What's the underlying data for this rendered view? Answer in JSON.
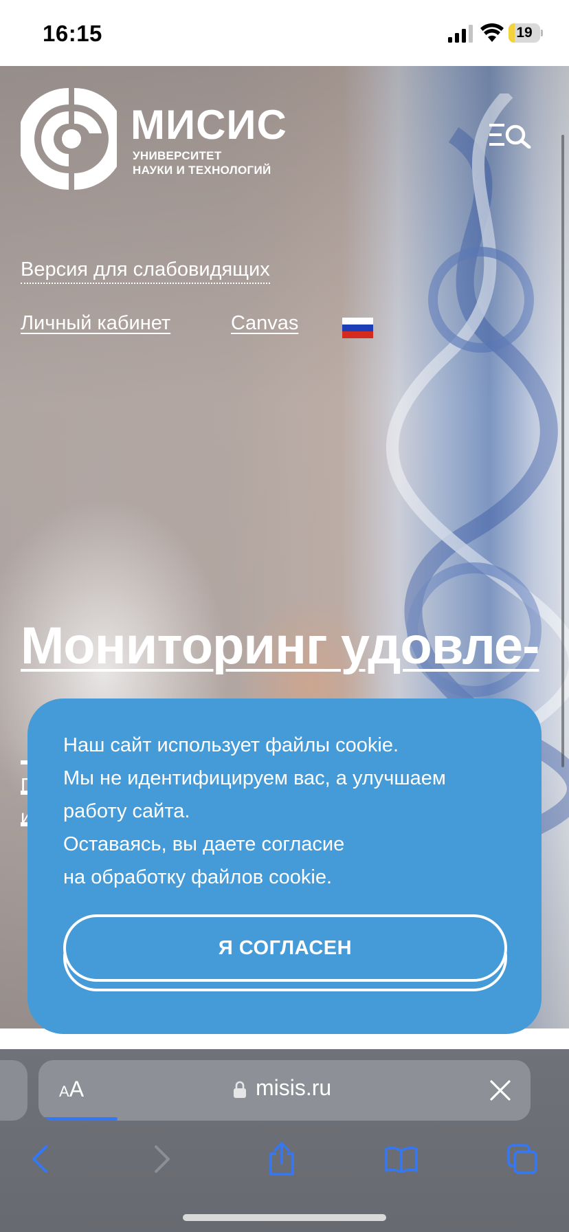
{
  "status_bar": {
    "time": "16:15",
    "battery_level": "19",
    "battery_fraction": 0.19,
    "icons": [
      "signal-icon",
      "wifi-icon",
      "battery-icon"
    ]
  },
  "site": {
    "brand_name": "МИСИС",
    "brand_sub_line1": "УНИВЕРСИТЕТ",
    "brand_sub_line2": "НАУКИ И ТЕХНОЛОГИЙ",
    "menu_icon": "menu-search-icon",
    "low_vision_link": "Версия для слабовидящих",
    "cabinet_link": "Личный кабинет",
    "canvas_link": "Canvas",
    "language_flag": "ru-flag-icon",
    "headline": "Мониторинг удовле-",
    "paragraph_frag1": "П",
    "paragraph_frag2": "и"
  },
  "cookie": {
    "lines": [
      "Наш сайт использует файлы cookie.",
      "Мы не идентифицируем вас, а улучшаем",
      "работу сайта.",
      "Оставаясь, вы даете согласие",
      "на обработку файлов cookie."
    ],
    "accept_label": "Я СОГЛАСЕН"
  },
  "browser": {
    "aa_small": "A",
    "aa_big": "A",
    "url": "misis.ru",
    "load_progress": 0.16,
    "toolbar_icons": [
      "back-icon",
      "forward-icon",
      "share-icon",
      "bookmarks-icon",
      "tabs-icon"
    ]
  },
  "colors": {
    "cookie_bg": "#459ad8",
    "browser_bar": "#6f7278",
    "accent_blue": "#3478f6",
    "battery_yellow": "#f2d33b"
  }
}
